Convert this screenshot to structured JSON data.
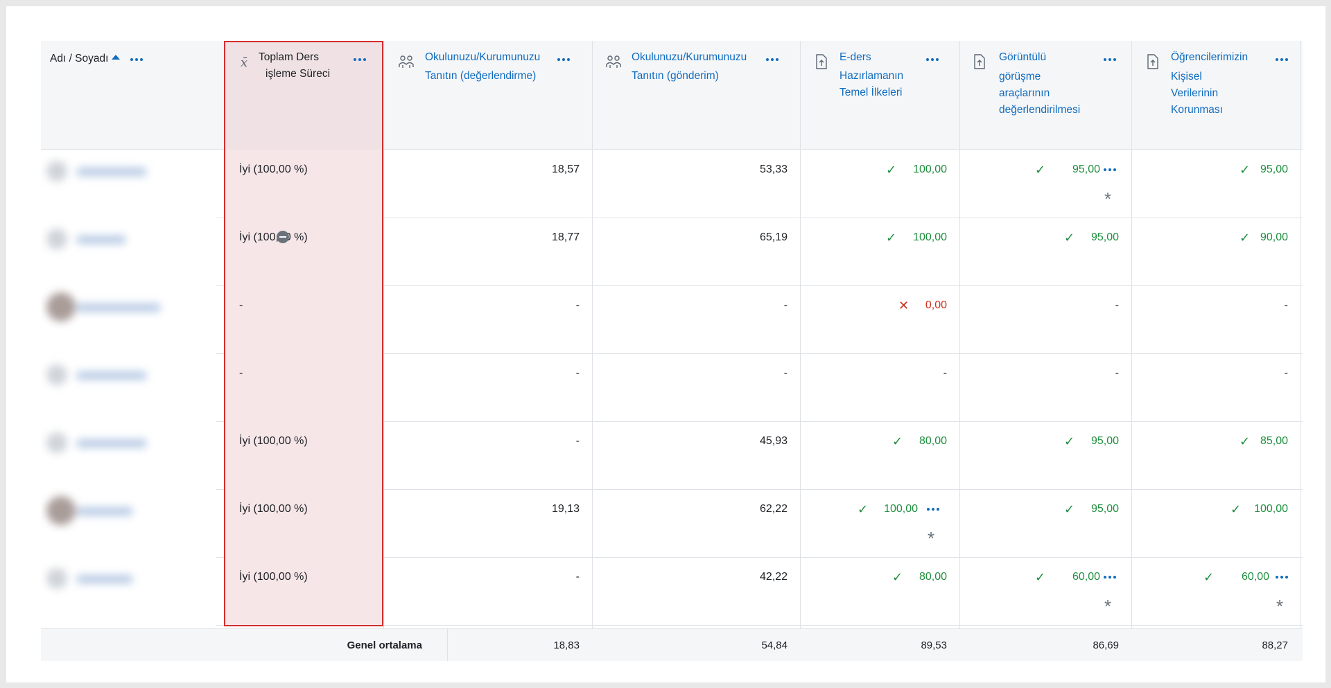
{
  "header": {
    "name_col": "Adı / Soyadı",
    "sum_col_line1": "Toplam Ders",
    "sum_col_line2": "işleme Süreci",
    "col1_line1": "Okulunuzu/Kurumunuzu",
    "col1_line2": "Tanıtın (değerlendirme)",
    "col2_line1": "Okulunuzu/Kurumunuzu",
    "col2_line2": "Tanıtın (gönderim)",
    "col3_line1": "E-ders",
    "col3_line2": "Hazırlamanın",
    "col3_line3": "Temel İlkeleri",
    "col4_line1": "Görüntülü",
    "col4_line2": "görüşme",
    "col4_line3": "araçlarının",
    "col4_line4": "değerlendirilmesi",
    "col5_line1": "Öğrencilerimizin",
    "col5_line2": "Kişisel",
    "col5_line3": "Verilerinin",
    "col5_line4": "Korunması"
  },
  "icons": {
    "sum": "sigma-icon",
    "workshop": "workshop-icon",
    "assign": "assignment-upload-icon"
  },
  "rows": [
    {
      "total": "İyi (100,00 %)",
      "c1": "18,57",
      "c2": "53,33",
      "c3": "100,00",
      "c4": "95,00",
      "c5": "95,00"
    },
    {
      "total": "İyi (100,00 %)",
      "c1": "18,77",
      "c2": "65,19",
      "c3": "100,00",
      "c4": "95,00",
      "c5": "90,00"
    },
    {
      "total": "-",
      "c1": "-",
      "c2": "-",
      "c3": "0,00",
      "c4": "-",
      "c5": "-"
    },
    {
      "total": "-",
      "c1": "-",
      "c2": "-",
      "c3": "-",
      "c4": "-",
      "c5": "-"
    },
    {
      "total": "İyi (100,00 %)",
      "c1": "-",
      "c2": "45,93",
      "c3": "80,00",
      "c4": "95,00",
      "c5": "85,00"
    },
    {
      "total": "İyi (100,00 %)",
      "c1": "19,13",
      "c2": "62,22",
      "c3": "100,00",
      "c4": "95,00",
      "c5": "100,00"
    },
    {
      "total": "İyi (100,00 %)",
      "c1": "-",
      "c2": "42,22",
      "c3": "80,00",
      "c4": "60,00",
      "c5": "60,00"
    }
  ],
  "footer": {
    "label": "Genel ortalama",
    "c1": "18,83",
    "c2": "54,84",
    "c3": "89,53",
    "c4": "86,69",
    "c5": "88,27"
  },
  "colors": {
    "link": "#0f6cbf",
    "pass": "#1e8e3e",
    "fail": "#ca3120",
    "highlight_border": "#d32f2f",
    "highlight_fill": "#f6e6e8"
  }
}
